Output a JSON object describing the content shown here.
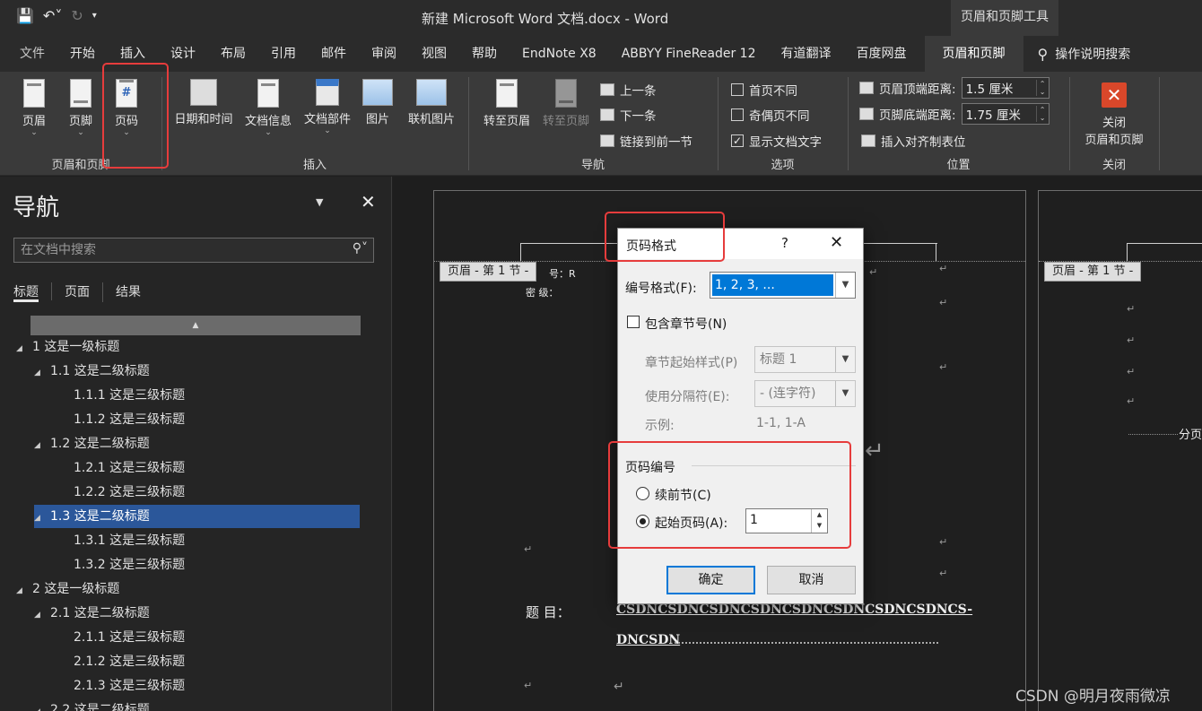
{
  "window": {
    "doc_title": "新建 Microsoft Word 文档.docx  -  Word",
    "tools_title": "页眉和页脚工具"
  },
  "qat": {
    "save_icon": "save-icon",
    "undo_icon": "undo-icon",
    "redo_icon": "redo-icon"
  },
  "tabs": [
    "文件",
    "开始",
    "插入",
    "设计",
    "布局",
    "引用",
    "邮件",
    "审阅",
    "视图",
    "帮助",
    "EndNote X8",
    "ABBYY FineReader 12",
    "有道翻译",
    "百度网盘"
  ],
  "active_tab": "页眉和页脚",
  "tell_me": "操作说明搜索",
  "ribbon": {
    "hf_group": {
      "header": "页眉",
      "footer": "页脚",
      "page_number": "页码",
      "label": "页眉和页脚"
    },
    "insert_group": {
      "date_time": "日期和时间",
      "doc_info": "文档信息",
      "quick_parts": "文档部件",
      "picture": "图片",
      "online_picture": "联机图片",
      "label": "插入"
    },
    "nav_group": {
      "goto_header": "转至页眉",
      "goto_footer": "转至页脚",
      "previous": "上一条",
      "next": "下一条",
      "link_prev": "链接到前一节",
      "label": "导航"
    },
    "options_group": {
      "diff_first": "首页不同",
      "diff_odd_even": "奇偶页不同",
      "show_doc_text": "显示文档文字",
      "label": "选项"
    },
    "position_group": {
      "header_from_top": "页眉顶端距离:",
      "header_value": "1.5 厘米",
      "footer_from_bottom": "页脚底端距离:",
      "footer_value": "1.75 厘米",
      "insert_align_tab": "插入对齐制表位",
      "label": "位置"
    },
    "close_group": {
      "close_line1": "关闭",
      "close_line2": "页眉和页脚",
      "label": "关闭"
    }
  },
  "nav": {
    "title": "导航",
    "search_placeholder": "在文档中搜索",
    "tabs": [
      "标题",
      "页面",
      "结果"
    ],
    "tree": [
      {
        "text": "1 这是一级标题",
        "level": 1
      },
      {
        "text": "1.1 这是二级标题",
        "level": 2
      },
      {
        "text": "1.1.1 这是三级标题",
        "level": 3
      },
      {
        "text": "1.1.2 这是三级标题",
        "level": 3
      },
      {
        "text": "1.2 这是二级标题",
        "level": 2
      },
      {
        "text": "1.2.1 这是三级标题",
        "level": 3
      },
      {
        "text": "1.2.2 这是三级标题",
        "level": 3
      },
      {
        "text": "1.3 这是二级标题",
        "level": 2,
        "selected": true
      },
      {
        "text": "1.3.1 这是三级标题",
        "level": 3
      },
      {
        "text": "1.3.2 这是三级标题",
        "level": 3
      },
      {
        "text": "2 这是一级标题",
        "level": 1
      },
      {
        "text": "2.1 这是二级标题",
        "level": 2
      },
      {
        "text": "2.1.1 这是三级标题",
        "level": 3
      },
      {
        "text": "2.1.2 这是三级标题",
        "level": 3
      },
      {
        "text": "2.1.3 这是三级标题",
        "level": 3
      },
      {
        "text": "2.2 这是二级标题",
        "level": 2
      }
    ]
  },
  "document": {
    "header_tag": "页眉 - 第 1 节 -",
    "header_tag_right": "页眉 - 第 1 节 -",
    "line_number": "号：R",
    "line_secret": "密    级：",
    "title_label": "题        目：",
    "title_line1": "CSDNCSDNCSDNCSDNCSDNCSDNCSDNCSDNCS-",
    "title_line2": "DNCSDN",
    "right_page_text": "分页",
    "para_mark": "↵"
  },
  "dialog": {
    "title": "页码格式",
    "help": "?",
    "number_format_label": "编号格式(F):",
    "number_format_value": "1, 2, 3, ...",
    "include_chapter_label": "包含章节号(N)",
    "chapter_style_label": "章节起始样式(P)",
    "chapter_style_value": "标题 1",
    "separator_label": "使用分隔符(E):",
    "separator_value": "-   (连字符)",
    "example_label": "示例:",
    "example_value": "1-1, 1-A",
    "page_numbering_label": "页码编号",
    "continue_label": "续前节(C)",
    "start_at_label": "起始页码(A):",
    "start_at_value": "1",
    "ok_label": "确定",
    "cancel_label": "取消"
  },
  "watermark": "CSDN @明月夜雨微凉",
  "colors": {
    "highlight_box": "#e63c3c",
    "selected_node": "#2b579a",
    "dialog_accent": "#0078d7"
  }
}
